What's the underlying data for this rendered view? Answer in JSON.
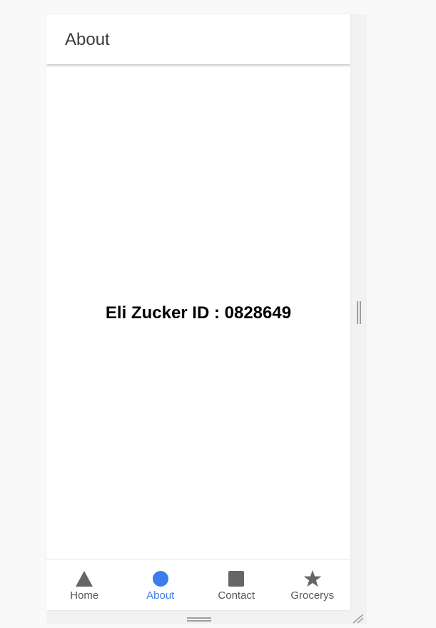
{
  "header": {
    "title": "About"
  },
  "main": {
    "text": "Eli Zucker ID : 0828649"
  },
  "tabs": [
    {
      "label": "Home",
      "icon": "triangle-icon",
      "active": false
    },
    {
      "label": "About",
      "icon": "circle-icon",
      "active": true
    },
    {
      "label": "Contact",
      "icon": "square-icon",
      "active": false
    },
    {
      "label": "Grocerys",
      "icon": "star-icon",
      "active": false
    }
  ],
  "colors": {
    "active": "#3b7ded",
    "inactive_icon": "#666666",
    "inactive_label": "#575757",
    "header_text": "#3c3c3c"
  }
}
